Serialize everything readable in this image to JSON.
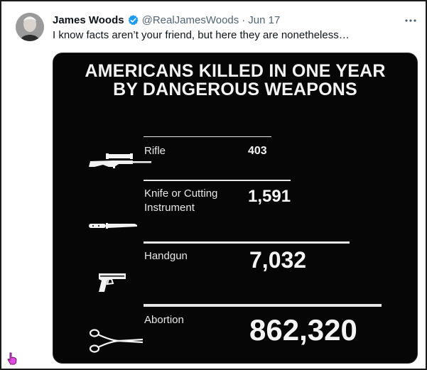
{
  "tweet": {
    "author_name": "James Woods",
    "handle": "@RealJamesWoods",
    "separator": "·",
    "date": "Jun 17",
    "text": "I know facts aren’t your friend, but here they are nonetheless…",
    "verified_color": "#1d9bf0"
  },
  "icons": {
    "avatar": "avatar",
    "verified": "verified-badge-icon",
    "more": "more-options-icon",
    "cursor": "hand-pointer-cursor-icon"
  },
  "infographic": {
    "title_line1": "AMERICANS KILLED IN ONE YEAR",
    "title_line2": "BY DANGEROUS WEAPONS",
    "rows": [
      {
        "label": "Rifle",
        "value": "403",
        "icon": "rifle-icon"
      },
      {
        "label_line1": "Knife or Cutting",
        "label_line2": "Instrument",
        "value": "1,591",
        "icon": "knife-icon"
      },
      {
        "label": "Handgun",
        "value": "7,032",
        "icon": "handgun-icon"
      },
      {
        "label": "Abortion",
        "value": "862,320",
        "icon": "surgical-forceps-icon"
      }
    ]
  }
}
